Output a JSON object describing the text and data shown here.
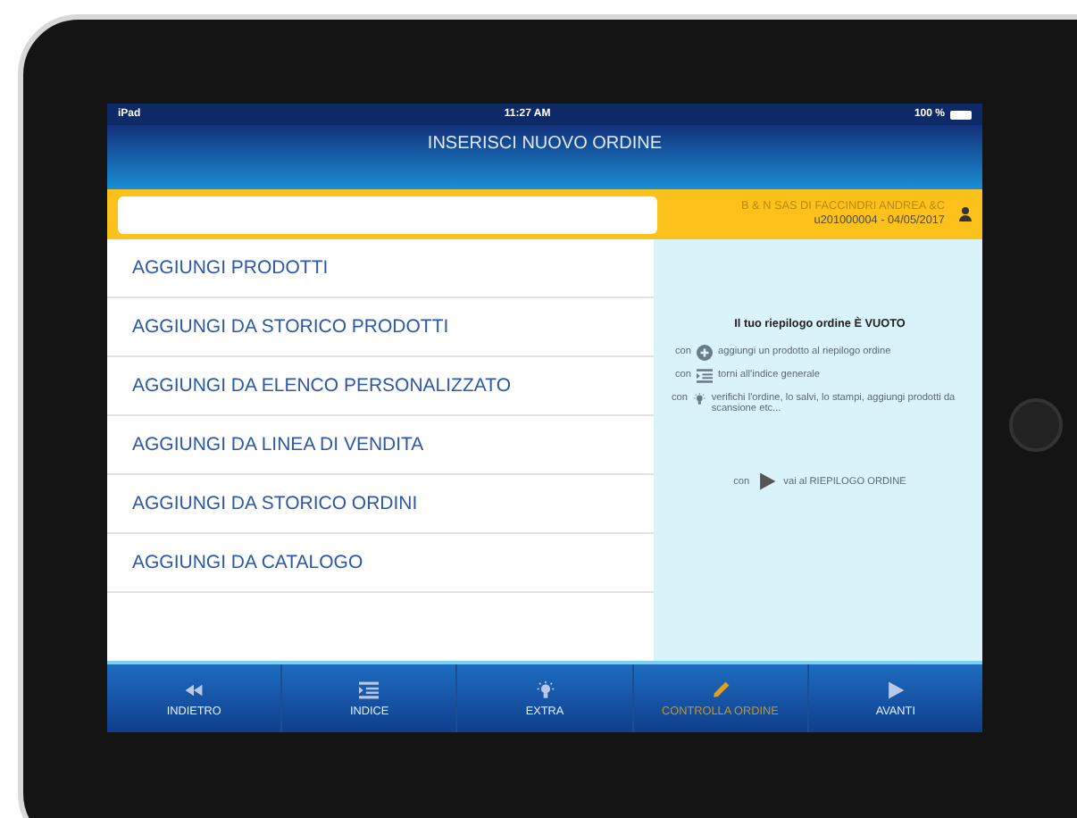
{
  "status_bar": {
    "carrier": "iPad",
    "time": "11:27 AM",
    "battery": "100 %"
  },
  "title": "INSERISCI NUOVO ORDINE",
  "order_bar": {
    "customer": "B & N SAS DI FACCINDRI ANDREA &C",
    "code": "u201000004 - 04/05/2017"
  },
  "menu": [
    {
      "label": "AGGIUNGI PRODOTTI"
    },
    {
      "label": "AGGIUNGI DA STORICO PRODOTTI"
    },
    {
      "label": "AGGIUNGI DA ELENCO PERSONALIZZATO"
    },
    {
      "label": "AGGIUNGI DA LINEA DI VENDITA"
    },
    {
      "label": "AGGIUNGI DA STORICO ORDINI"
    },
    {
      "label": "AGGIUNGI DA CATALOGO"
    }
  ],
  "summary": {
    "heading": "Il tuo riepilogo ordine È VUOTO",
    "tips": [
      {
        "kind": "plus",
        "prefix": "con",
        "text": "aggiungi un prodotto al riepilogo ordine"
      },
      {
        "kind": "index",
        "prefix": "con",
        "text": "torni all'indice generale"
      },
      {
        "kind": "bulb",
        "prefix": "con",
        "text": "verifichi l'ordine, lo salvi, lo stampi, aggiungi prodotti da scansione etc..."
      }
    ],
    "final": {
      "kind": "play",
      "prefix": "con",
      "text": "vai al RIEPILOGO ORDINE"
    }
  },
  "toolbar": [
    {
      "kind": "rewind",
      "label": "INDIETRO",
      "selected": false
    },
    {
      "kind": "index",
      "label": "INDICE",
      "selected": false
    },
    {
      "kind": "bulb",
      "label": "EXTRA",
      "selected": false
    },
    {
      "kind": "pencil",
      "label": "CONTROLLA ORDINE",
      "selected": true
    },
    {
      "kind": "play",
      "label": "AVANTI",
      "selected": false
    }
  ]
}
